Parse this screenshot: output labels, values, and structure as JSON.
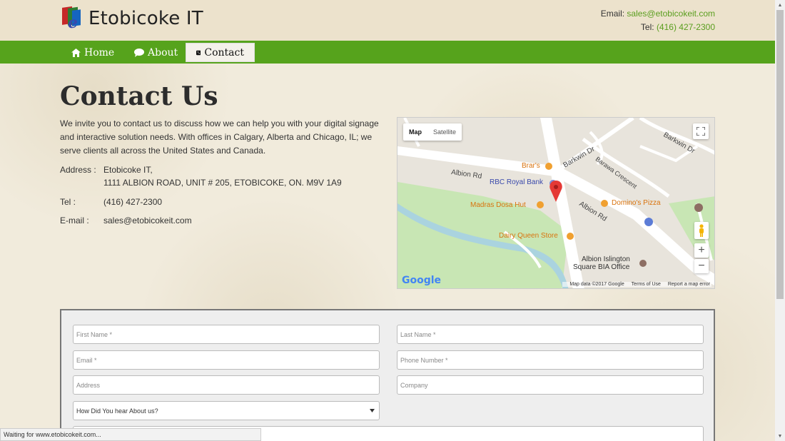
{
  "header": {
    "logo_text": "Etobicoke IT",
    "email_label": "Email: ",
    "email": "sales@etobicokeit.com",
    "tel_label": "Tel: ",
    "tel": "(416) 427-2300"
  },
  "nav": {
    "home": "Home",
    "about": "About",
    "contact": "Contact"
  },
  "main": {
    "title": "Contact Us",
    "intro": "We invite you to contact us to discuss how we can help you with your digital signage and interactive solution needs. With offices in Calgary, Alberta and Chicago, IL; we serve clients all across the United States and Canada.",
    "address_label": "Address :",
    "address_line1": "Etobicoke IT,",
    "address_line2": "1111 ALBION ROAD, UNIT #  205, ETOBICOKE, ON. M9V 1A9",
    "tel_label": "Tel :",
    "tel_value": "(416) 427-2300",
    "email_label": "E-mail :",
    "email_value": "sales@etobicokeit.com"
  },
  "map": {
    "map_tab": "Map",
    "satellite_tab": "Satellite",
    "labels": {
      "brars": "Brar's",
      "rbc": "RBC Royal Bank",
      "dominos": "Domino's Pizza",
      "madras": "Madras Dosa Hut",
      "dairy_queen": "Dairy Queen Store",
      "albion_islington": "Albion Islington",
      "square_bia": "Square BIA Office",
      "albion_rd_1": "Albion Rd",
      "albion_rd_2": "Albion Rd",
      "barkwin_dr_1": "Barkwin Dr",
      "barkwin_dr_2": "Barkwin Dr",
      "barawa": "Barawa Crescent"
    },
    "google": "Google",
    "footer_data": "Map data ©2017 Google",
    "footer_terms": "Terms of Use",
    "footer_report": "Report a map error",
    "zoom_in": "+",
    "zoom_out": "−"
  },
  "form": {
    "first_name": "First Name *",
    "last_name": "Last Name *",
    "email": "Email *",
    "phone": "Phone Number *",
    "address": "Address",
    "company": "Company",
    "how_heard": "How Did You hear About us?"
  },
  "status": {
    "text": "Waiting for www.etobicokeit.com..."
  },
  "colors": {
    "brand_green": "#56a31c",
    "link_green": "#5a9e1e",
    "header_bg": "#ece2cc"
  }
}
